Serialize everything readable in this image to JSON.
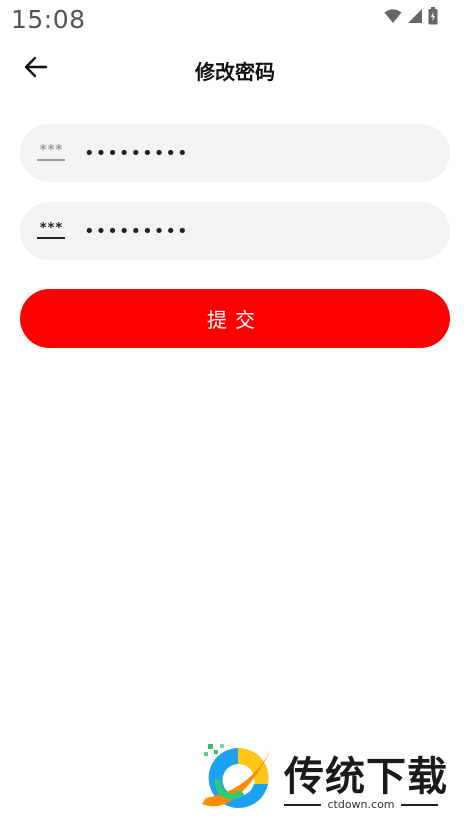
{
  "status_bar": {
    "time": "15:08",
    "icons": [
      "wifi-icon",
      "cellular-signal-icon",
      "battery-charging-icon"
    ]
  },
  "header": {
    "title": "修改密码",
    "back_icon": "arrow-left-icon"
  },
  "form": {
    "fields": [
      {
        "value": "•••••••••",
        "icon": "password-icon"
      },
      {
        "value": "•••••••••",
        "icon": "password-icon"
      }
    ],
    "submit_label": "提交"
  },
  "watermark": {
    "name": "传统下载",
    "site": "ctdown.com"
  },
  "colors": {
    "accent": "#ff0000",
    "field_bg": "#f3f3f3"
  }
}
